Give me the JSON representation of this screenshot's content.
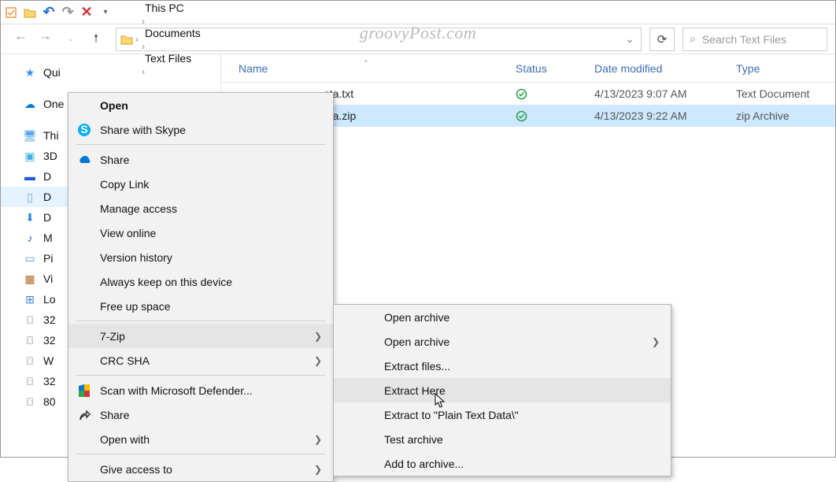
{
  "watermark": "groovyPost.com",
  "titlebar": {
    "icons": [
      "check",
      "folder",
      "undo",
      "redo",
      "close",
      "dropdown"
    ]
  },
  "toolbar": {
    "breadcrumb": [
      "This PC",
      "Documents",
      "Text Files"
    ],
    "search_placeholder": "Search Text Files"
  },
  "columns": {
    "name": "Name",
    "status": "Status",
    "date": "Date modified",
    "type": "Type"
  },
  "rows": [
    {
      "name": "ata.txt",
      "status": "✓",
      "date": "4/13/2023 9:07 AM",
      "type": "Text Document",
      "selected": false
    },
    {
      "name": "ata.zip",
      "status": "✓",
      "date": "4/13/2023 9:22 AM",
      "type": "zip Archive",
      "selected": true
    }
  ],
  "sidebar": [
    {
      "label": "Qui",
      "icon": "★",
      "color": "#3a8fe6"
    },
    {
      "gap": true
    },
    {
      "label": "One",
      "icon": "☁",
      "color": "#0078d4"
    },
    {
      "gap": true
    },
    {
      "label": "Thi",
      "icon": "🖥",
      "color": "#5aa7e6"
    },
    {
      "label": "3D",
      "icon": "▣",
      "color": "#3bb0e2"
    },
    {
      "label": "D",
      "icon": "▬",
      "color": "#1e5cd2"
    },
    {
      "label": "D",
      "icon": "▯",
      "color": "#6aa6d8",
      "selected": true
    },
    {
      "label": "D",
      "icon": "⬇",
      "color": "#2a8fd6"
    },
    {
      "label": "M",
      "icon": "♪",
      "color": "#2c5bd6"
    },
    {
      "label": "Pi",
      "icon": "▭",
      "color": "#4aa0d8"
    },
    {
      "label": "Vi",
      "icon": "▦",
      "color": "#b06a2a"
    },
    {
      "label": "Lo",
      "icon": "⊞",
      "color": "#3b82d8"
    },
    {
      "label": "32",
      "icon": "⌼",
      "color": "#888"
    },
    {
      "label": "32",
      "icon": "⌼",
      "color": "#888"
    },
    {
      "label": "W",
      "icon": "⌼",
      "color": "#888"
    },
    {
      "label": "32",
      "icon": "⌼",
      "color": "#888"
    },
    {
      "label": "80",
      "icon": "⌼",
      "color": "#888"
    }
  ],
  "context_menu_1": [
    {
      "type": "item",
      "label": "Open",
      "bold": true
    },
    {
      "type": "item",
      "label": "Share with Skype",
      "icon": "skype"
    },
    {
      "type": "sep"
    },
    {
      "type": "item",
      "label": "Share",
      "icon": "cloud"
    },
    {
      "type": "item",
      "label": "Copy Link"
    },
    {
      "type": "item",
      "label": "Manage access"
    },
    {
      "type": "item",
      "label": "View online"
    },
    {
      "type": "item",
      "label": "Version history"
    },
    {
      "type": "item",
      "label": "Always keep on this device"
    },
    {
      "type": "item",
      "label": "Free up space"
    },
    {
      "type": "sep"
    },
    {
      "type": "item",
      "label": "7-Zip",
      "submenu": true,
      "hov": true
    },
    {
      "type": "item",
      "label": "CRC SHA",
      "submenu": true
    },
    {
      "type": "sep"
    },
    {
      "type": "item",
      "label": "Scan with Microsoft Defender...",
      "icon": "shield"
    },
    {
      "type": "item",
      "label": "Share",
      "icon": "share"
    },
    {
      "type": "item",
      "label": "Open with",
      "submenu": true
    },
    {
      "type": "sep"
    },
    {
      "type": "item",
      "label": "Give access to",
      "submenu": true
    }
  ],
  "context_menu_2": [
    {
      "type": "item",
      "label": "Open archive"
    },
    {
      "type": "item",
      "label": "Open archive",
      "submenu": true
    },
    {
      "type": "item",
      "label": "Extract files..."
    },
    {
      "type": "item",
      "label": "Extract Here",
      "hov": true
    },
    {
      "type": "item",
      "label": "Extract to \"Plain Text Data\\\""
    },
    {
      "type": "item",
      "label": "Test archive"
    },
    {
      "type": "item",
      "label": "Add to archive..."
    }
  ]
}
